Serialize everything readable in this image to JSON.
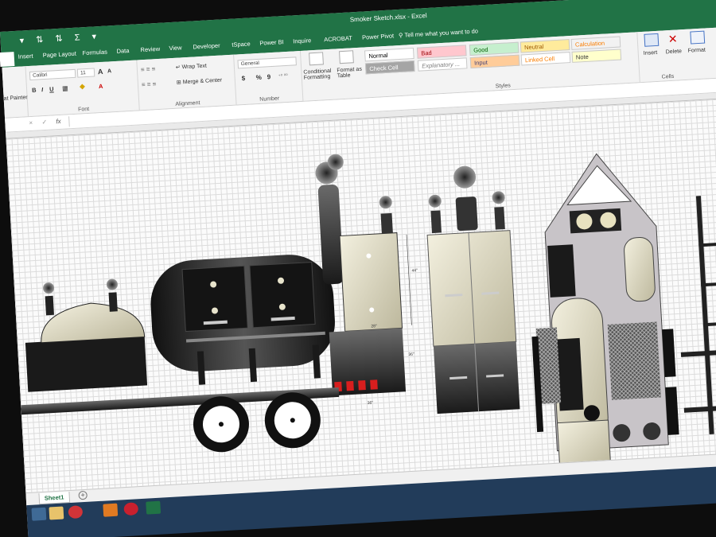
{
  "window": {
    "title": "Smoker Sketch.xlsx  -  Excel"
  },
  "ribbon_tabs": [
    "Insert",
    "Page Layout",
    "Formulas",
    "Data",
    "Review",
    "View",
    "Developer",
    "tSpace",
    "Power BI",
    "Inquire",
    "ACROBAT",
    "Power Pivot"
  ],
  "tell_me": "Tell me what you want to do",
  "clipboard": {
    "format_painter": "at Painter",
    "label": ""
  },
  "font": {
    "name": "Calibri",
    "size": "11",
    "bold": "B",
    "italic": "I",
    "underline": "U",
    "grow": "A",
    "shrink": "A",
    "color_btn": "A",
    "label": "Font"
  },
  "alignment": {
    "wrap_text": "Wrap Text",
    "merge_center": "Merge & Center",
    "label": "Alignment"
  },
  "number": {
    "format": "General",
    "currency": "$",
    "percent": "%",
    "comma": "9",
    "label": "Number"
  },
  "conditional": {
    "label1": "Conditional",
    "label2": "Formatting"
  },
  "format_table": {
    "label1": "Format as",
    "label2": "Table"
  },
  "styles": {
    "label": "Styles",
    "items": [
      {
        "name": "Normal",
        "bg": "#ffffff",
        "fg": "#000000"
      },
      {
        "name": "Bad",
        "bg": "#ffc7ce",
        "fg": "#9c0006"
      },
      {
        "name": "Good",
        "bg": "#c6efce",
        "fg": "#006100"
      },
      {
        "name": "Neutral",
        "bg": "#ffeb9c",
        "fg": "#9c5700"
      },
      {
        "name": "Calculation",
        "bg": "#f2f2f2",
        "fg": "#fa7d00"
      },
      {
        "name": "Check Cell",
        "bg": "#a5a5a5",
        "fg": "#ffffff"
      },
      {
        "name": "Explanatory ...",
        "bg": "#ffffff",
        "fg": "#7f7f7f"
      },
      {
        "name": "Input",
        "bg": "#ffcc99",
        "fg": "#3f3f76"
      },
      {
        "name": "Linked Cell",
        "bg": "#ffffff",
        "fg": "#fa7d00"
      },
      {
        "name": "Note",
        "bg": "#ffffcc",
        "fg": "#333333"
      }
    ]
  },
  "cells": {
    "insert": "Insert",
    "delete": "Delete",
    "format": "Format",
    "label": "Cells"
  },
  "formula_bar": {
    "cancel": "×",
    "enter": "✓",
    "fx": "fx",
    "value": ""
  },
  "drawing": {
    "dim_height": "44\"",
    "dim_mid": "36\"",
    "dim_bottom": "36\"",
    "dim_inner": "28\""
  },
  "sheet_tab": "Sheet1",
  "add_sheet": "+",
  "colors": {
    "excel_green": "#217346",
    "taskbar": "#223c5a"
  }
}
